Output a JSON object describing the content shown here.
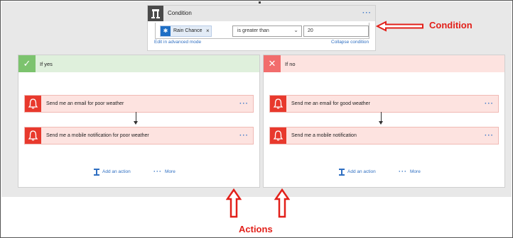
{
  "condition": {
    "title": "Condition",
    "token": {
      "label": "Rain Chance",
      "remove": "×"
    },
    "operator": "is greater than",
    "value": "20",
    "edit_link": "Edit in advanced mode",
    "collapse_link": "Collapse condition",
    "menu": "···"
  },
  "branches": [
    {
      "title": "If yes",
      "header_icon": "check-icon",
      "actions": [
        "Send me an email for poor weather",
        "Send me a mobile notification for poor weather"
      ],
      "add_action": "Add an action",
      "more": "More",
      "menu": "···"
    },
    {
      "title": "If no",
      "header_icon": "close-icon",
      "actions": [
        "Send me an email for good weather",
        "Send me a mobile notification"
      ],
      "add_action": "Add an action",
      "more": "More",
      "menu": "···"
    }
  ],
  "annotations": {
    "condition": "Condition",
    "actions": "Actions"
  },
  "colors": {
    "annotation": "#e2201a",
    "link": "#2f6fc2",
    "yes": "#7cc36e",
    "no": "#f26d6d",
    "action_icon": "#e8392d"
  }
}
